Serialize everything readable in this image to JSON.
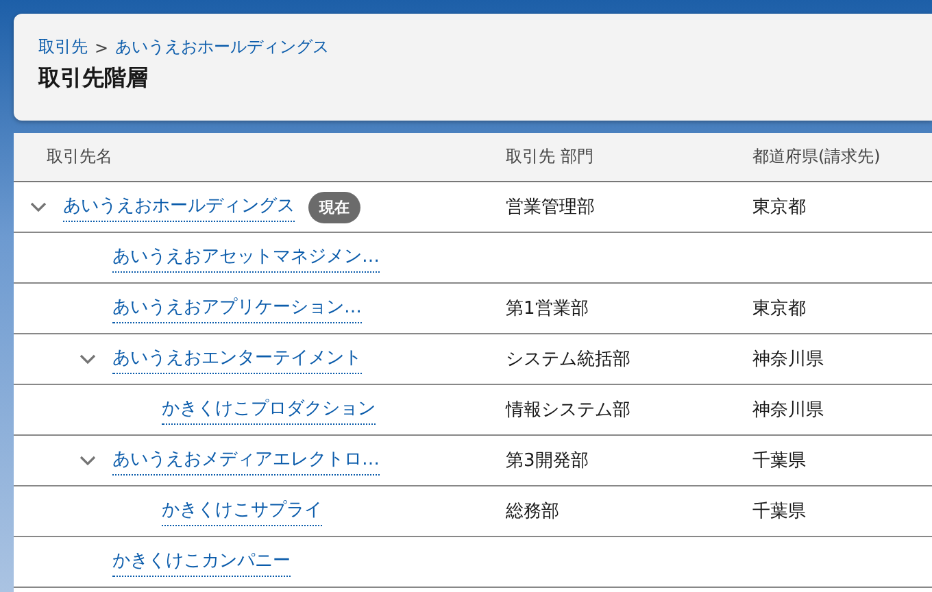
{
  "header": {
    "breadcrumbs": [
      "取引先",
      "あいうえおホールディングス"
    ],
    "breadcrumb_separator": ">",
    "title": "取引先階層"
  },
  "table": {
    "columns": [
      "取引先名",
      "取引先 部門",
      "都道府県(請求先)"
    ],
    "rows": [
      {
        "name": "あいうえおホールディングス",
        "badge": "現在",
        "department": "営業管理部",
        "prefecture": "東京都",
        "expanded": true,
        "children": [
          {
            "name": "あいうえおアセットマネジメン…"
          },
          {
            "name": "あいうえおアプリケーション…",
            "department": "第1営業部",
            "prefecture": "東京都"
          },
          {
            "name": "あいうえおエンターテイメント",
            "department": "システム統括部",
            "prefecture": "神奈川県",
            "expanded": true,
            "children": [
              {
                "name": "かきくけこプロダクション",
                "department": "情報システム部",
                "prefecture": "神奈川県"
              }
            ]
          },
          {
            "name": "あいうえおメディアエレクトロ…",
            "department": "第3開発部",
            "prefecture": "千葉県",
            "expanded": true,
            "children": [
              {
                "name": "かきくけこサプライ",
                "department": "総務部",
                "prefecture": "千葉県"
              }
            ]
          },
          {
            "name": "かきくけこカンパニー"
          }
        ]
      }
    ]
  }
}
